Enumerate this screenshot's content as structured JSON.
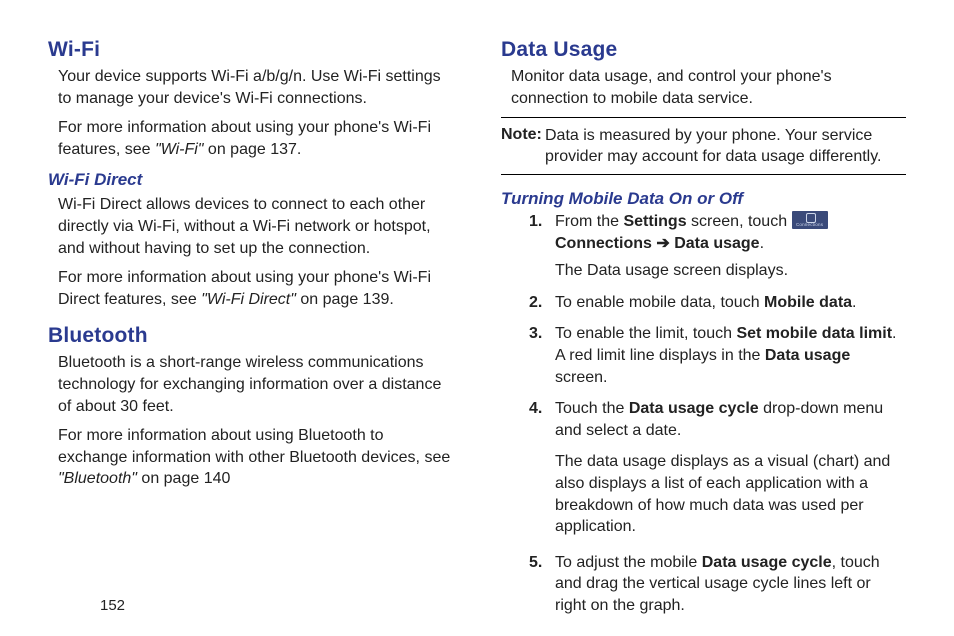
{
  "pageNumber": "152",
  "left": {
    "wifi": {
      "title": "Wi-Fi",
      "p1a": "Your device supports Wi-Fi a/b/g/n. Use Wi-Fi settings to manage your device's Wi-Fi connections.",
      "p2a": "For more information about using your phone's Wi-Fi features, see ",
      "p2ref": "\"Wi-Fi\"",
      "p2b": " on page 137."
    },
    "wifiDirect": {
      "title": "Wi-Fi Direct",
      "p1": "Wi-Fi Direct allows devices to connect to each other directly via Wi-Fi, without a Wi-Fi network or hotspot, and without having to set up the connection.",
      "p2a": "For more information about using your phone's Wi-Fi Direct features, see ",
      "p2ref": "\"Wi-Fi Direct\"",
      "p2b": " on page 139."
    },
    "bluetooth": {
      "title": "Bluetooth",
      "p1": "Bluetooth is a short-range wireless communications technology for exchanging information over a distance of about 30 feet.",
      "p2a": "For more information about using Bluetooth to exchange information with other Bluetooth devices, see ",
      "p2ref": "\"Bluetooth\"",
      "p2b": " on page 140"
    }
  },
  "right": {
    "dataUsage": {
      "title": "Data Usage",
      "p1": "Monitor data usage, and control your phone's connection to mobile data service.",
      "noteLabel": "Note:",
      "noteBody": "Data is measured by your phone. Your service provider may account for data usage differently."
    },
    "turning": {
      "title": "Turning Mobile Data On or Off",
      "s1": {
        "from": "From the ",
        "settings": "Settings",
        "touch": " screen, touch ",
        "conn": " Connections ",
        "arrow": "➔",
        "du": " Data usage",
        "dot": ".",
        "sub": "The Data usage screen displays."
      },
      "s2": {
        "a": "To enable mobile data, touch ",
        "b": "Mobile data",
        "c": "."
      },
      "s3": {
        "a": "To enable the limit, touch ",
        "b": "Set mobile data limit",
        "c": ". A red limit line displays in the ",
        "d": "Data usage",
        "e": " screen."
      },
      "s4": {
        "a": "Touch the ",
        "b": "Data usage cycle",
        "c": " drop-down menu and select a date.",
        "sub": "The data usage displays as a visual (chart) and also displays a list of each application with a breakdown of how much data was used per application."
      },
      "s5": {
        "a": "To adjust the mobile ",
        "b": "Data usage cycle",
        "c": ", touch and drag the vertical usage cycle lines left or right on the graph."
      }
    }
  }
}
